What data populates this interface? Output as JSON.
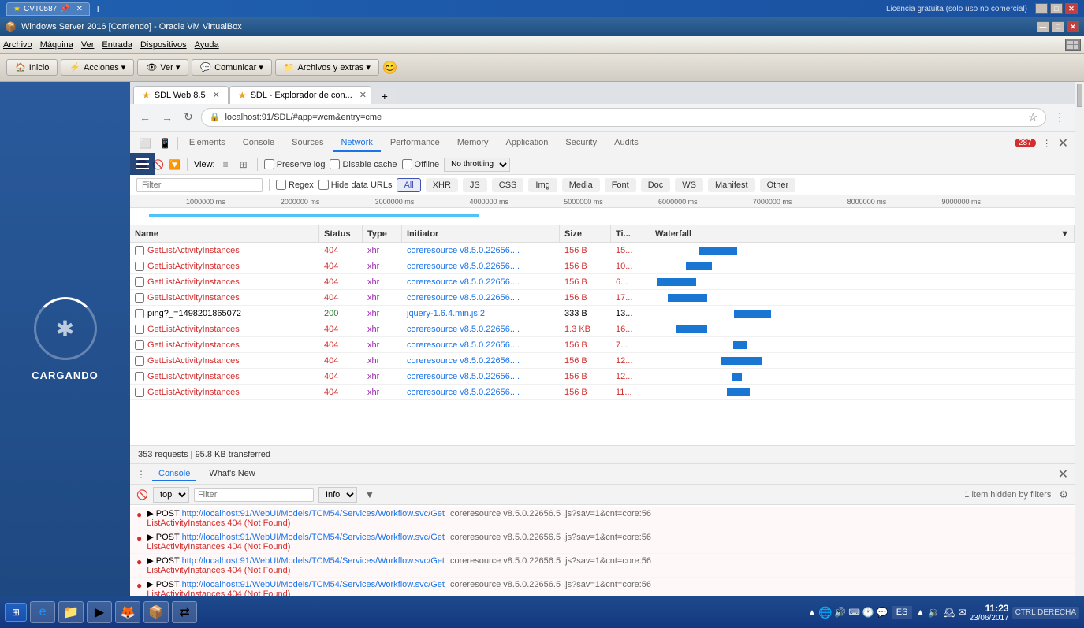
{
  "os": {
    "titlebar": {
      "tab_label": "CVT0587",
      "license_text": "Licencia gratuita (solo uso no comercial)"
    },
    "vbox": {
      "title": "Windows Server 2016 [Corriendo] - Oracle VM VirtualBox",
      "menu_items": [
        "Archivo",
        "Máquina",
        "Ver",
        "Entrada",
        "Dispositivos",
        "Ayuda"
      ],
      "toolbar_items": [
        "Inicio",
        "Acciones ▾",
        "Ver ▾",
        "Comunicar ▾",
        "Archivos y extras ▾"
      ]
    }
  },
  "browser": {
    "tabs": [
      {
        "id": "tab1",
        "favicon": "★",
        "label": "SDL Web 8.5",
        "active": true
      },
      {
        "id": "tab2",
        "favicon": "★",
        "label": "SDL - Explorador de con...",
        "active": false
      }
    ],
    "url": "localhost:91/SDL/#app=wcm&entry=cme"
  },
  "devtools": {
    "tabs": [
      "Elements",
      "Console",
      "Sources",
      "Network",
      "Performance",
      "Memory",
      "Application",
      "Security",
      "Audits"
    ],
    "active_tab": "Network",
    "error_count": "287",
    "toolbar": {
      "view_label": "View:",
      "preserve_log": "Preserve log",
      "disable_cache": "Disable cache",
      "offline": "Offline",
      "throttle": "No throttling"
    },
    "filter_placeholder": "Filter",
    "filter_types": [
      "All",
      "XHR",
      "JS",
      "CSS",
      "Img",
      "Media",
      "Font",
      "Doc",
      "WS",
      "Manifest",
      "Other"
    ],
    "active_filter": "All",
    "timeline": {
      "marks": [
        "1000000 ms",
        "2000000 ms",
        "3000000 ms",
        "4000000 ms",
        "5000000 ms",
        "6000000 ms",
        "7000000 ms",
        "8000000 ms",
        "9000000 ms"
      ]
    },
    "table": {
      "headers": [
        "Name",
        "Status",
        "Type",
        "Initiator",
        "Size",
        "Ti...",
        "Waterfall"
      ],
      "rows": [
        {
          "name": "GetListActivityInstances",
          "status": "404",
          "type": "xhr",
          "initiator": "coreresource v8.5.0.22656....",
          "size": "156 B",
          "time": "15...",
          "error": true
        },
        {
          "name": "GetListActivityInstances",
          "status": "404",
          "type": "xhr",
          "initiator": "coreresource v8.5.0.22656....",
          "size": "156 B",
          "time": "10...",
          "error": true
        },
        {
          "name": "GetListActivityInstances",
          "status": "404",
          "type": "xhr",
          "initiator": "coreresource v8.5.0.22656....",
          "size": "156 B",
          "time": "6...",
          "error": true
        },
        {
          "name": "GetListActivityInstances",
          "status": "404",
          "type": "xhr",
          "initiator": "coreresource v8.5.0.22656....",
          "size": "156 B",
          "time": "17...",
          "error": true
        },
        {
          "name": "ping?_=1498201865072",
          "status": "200",
          "type": "xhr",
          "initiator": "jquery-1.6.4.min.js:2",
          "size": "333 B",
          "time": "13...",
          "error": false
        },
        {
          "name": "GetListActivityInstances",
          "status": "404",
          "type": "xhr",
          "initiator": "coreresource v8.5.0.22656....",
          "size": "1.3 KB",
          "time": "16...",
          "error": true
        },
        {
          "name": "GetListActivityInstances",
          "status": "404",
          "type": "xhr",
          "initiator": "coreresource v8.5.0.22656....",
          "size": "156 B",
          "time": "7...",
          "error": true
        },
        {
          "name": "GetListActivityInstances",
          "status": "404",
          "type": "xhr",
          "initiator": "coreresource v8.5.0.22656....",
          "size": "156 B",
          "time": "12...",
          "error": true
        },
        {
          "name": "GetListActivityInstances",
          "status": "404",
          "type": "xhr",
          "initiator": "coreresource v8.5.0.22656....",
          "size": "156 B",
          "time": "12...",
          "error": true
        },
        {
          "name": "GetListActivityInstances",
          "status": "404",
          "type": "xhr",
          "initiator": "coreresource v8.5.0.22656....",
          "size": "156 B",
          "time": "11...",
          "error": true
        }
      ]
    },
    "summary": "353 requests | 95.8 KB transferred"
  },
  "console": {
    "tabs": [
      "Console",
      "What's New"
    ],
    "active_tab": "Console",
    "toolbar": {
      "context": "top",
      "filter_placeholder": "Filter",
      "level": "Info"
    },
    "hidden_text": "1 item hidden by filters",
    "entries": [
      {
        "type": "error",
        "prefix": "▶ POST",
        "url": "http://localhost:91/WebUI/Models/TCM54/Services/Workflow.svc/Get",
        "source": "coreresource v8.5.0.22656.5 .js?sav=1&cnt=core:56",
        "detail": "ListActivityInstances 404 (Not Found)"
      },
      {
        "type": "error",
        "prefix": "▶ POST",
        "url": "http://localhost:91/WebUI/Models/TCM54/Services/Workflow.svc/Get",
        "source": "coreresource v8.5.0.22656.5 .js?sav=1&cnt=core:56",
        "detail": "ListActivityInstances 404 (Not Found)"
      },
      {
        "type": "error",
        "prefix": "▶ POST",
        "url": "http://localhost:91/WebUI/Models/TCM54/Services/Workflow.svc/Get",
        "source": "coreresource v8.5.0.22656.5 .js?sav=1&cnt=core:56",
        "detail": "ListActivityInstances 404 (Not Found)"
      },
      {
        "type": "error",
        "prefix": "▶ POST",
        "url": "http://localhost:91/WebUI/Models/TCM54/Services/Workflow.svc/Get",
        "source": "coreresource v8.5.0.22656.5 .js?sav=1&cnt=core:56",
        "detail": "ListActivityInstances 404 (Not Found)"
      }
    ]
  },
  "sidebar": {
    "loading_text": "CARGANDO"
  },
  "taskbar": {
    "time": "11:23",
    "date": "23/06/2017",
    "language": "ES",
    "ctrl_text": "CTRL DERECHA"
  }
}
